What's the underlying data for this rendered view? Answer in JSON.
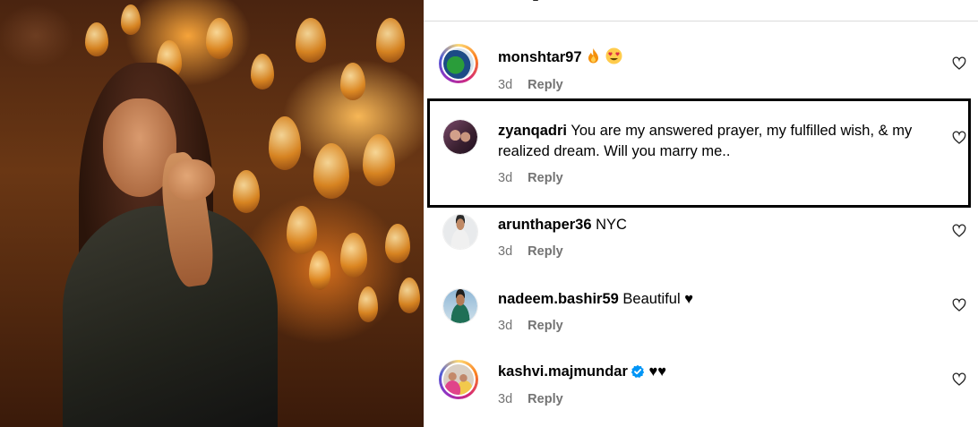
{
  "comments": [
    {
      "username": "monshtar97",
      "text": "",
      "time": "3d",
      "reply": "Reply",
      "emoji": [
        "fire",
        "heart-eyes"
      ],
      "avatar": "avatar-monshtar97"
    },
    {
      "username": "zyanqadri",
      "text": "You are my answered prayer, my fulfilled wish, & my",
      "text2": "realized dream. Will you marry me..",
      "time": "3d",
      "reply": "Reply",
      "avatar": "avatar-zyanqadri"
    },
    {
      "username": "arunthaper36",
      "text": "NYC",
      "time": "3d",
      "reply": "Reply",
      "avatar": "avatar-arunthaper36"
    },
    {
      "username": "nadeem.bashir59",
      "text": "Beautiful ♥",
      "time": "3d",
      "reply": "Reply",
      "avatar": "avatar-nadeem"
    },
    {
      "username": "kashvi.majmundar",
      "text": "♥♥",
      "time": "3d",
      "reply": "Reply",
      "verified": true,
      "avatar": "avatar-kashvi"
    }
  ],
  "icons": {
    "like": "heart-outline-icon",
    "verified": "verified-badge-icon"
  },
  "colors": {
    "muted": "#737373",
    "highlight": "#000000",
    "verified": "#0095f6"
  }
}
